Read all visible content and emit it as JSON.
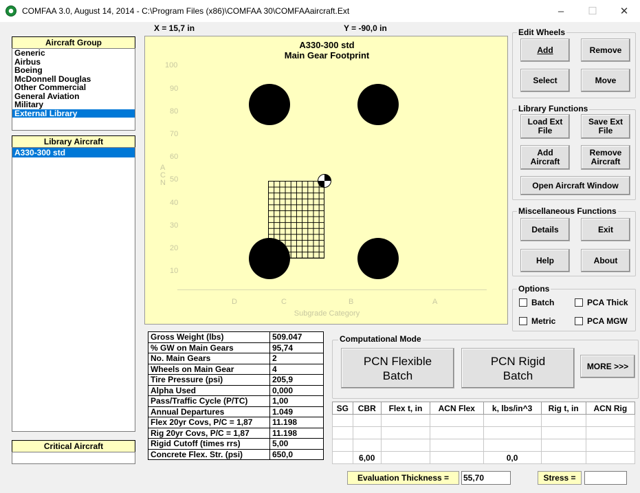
{
  "window": {
    "title": "COMFAA 3.0, August 14, 2014 - C:\\Program Files (x86)\\COMFAA 30\\COMFAAaircraft.Ext",
    "min_glyph": "–",
    "max_glyph": "☐",
    "close_glyph": "✕"
  },
  "coords": {
    "x": "X = 15,7 in",
    "y": "Y = -90,0 in"
  },
  "aircraft_group": {
    "header": "Aircraft Group",
    "items": [
      "Generic",
      "Airbus",
      "Boeing",
      "McDonnell Douglas",
      "Other Commercial",
      "General Aviation",
      "Military",
      "External Library"
    ],
    "selected_index": 7
  },
  "library_aircraft": {
    "header": "Library Aircraft",
    "items": [
      "A330-300 std"
    ],
    "selected_index": 0
  },
  "critical_aircraft": {
    "header": "Critical Aircraft",
    "value": ""
  },
  "plot": {
    "title1": "A330-300 std",
    "title2": "Main Gear Footprint",
    "y_ticks": [
      "100",
      "90",
      "80",
      "70",
      "60",
      "50",
      "40",
      "30",
      "20",
      "10"
    ],
    "y_axis_letters": [
      "A",
      "C",
      "N"
    ],
    "x_ticks": [
      "D",
      "C",
      "B",
      "A"
    ],
    "x_label": "Subgrade Category"
  },
  "edit_wheels": {
    "label": "Edit Wheels",
    "add": "Add",
    "remove": "Remove",
    "select": "Select",
    "move": "Move"
  },
  "library_functions": {
    "label": "Library Functions",
    "load": "Load Ext\nFile",
    "save": "Save Ext\nFile",
    "add_aircraft": "Add\nAircraft",
    "remove_aircraft": "Remove\nAircraft",
    "open_window": "Open Aircraft Window"
  },
  "misc": {
    "label": "Miscellaneous Functions",
    "details": "Details",
    "exit": "Exit",
    "help": "Help",
    "about": "About"
  },
  "options": {
    "label": "Options",
    "batch": "Batch",
    "pca_thick": "PCA Thick",
    "metric": "Metric",
    "pca_mgw": "PCA MGW"
  },
  "params": [
    {
      "label": "Gross Weight (lbs)",
      "value": "509.047"
    },
    {
      "label": "% GW on Main Gears",
      "value": "95,74"
    },
    {
      "label": "No. Main Gears",
      "value": "2"
    },
    {
      "label": "Wheels on Main Gear",
      "value": "4"
    },
    {
      "label": "Tire Pressure (psi)",
      "value": "205,9"
    },
    {
      "label": "Alpha Used",
      "value": "0,000"
    },
    {
      "label": "Pass/Traffic Cycle (P/TC)",
      "value": "1,00"
    },
    {
      "label": "Annual Departures",
      "value": "1.049"
    },
    {
      "label": "Flex 20yr Covs, P/C = 1,87",
      "value": "11.198"
    },
    {
      "label": "Rig 20yr Covs,  P/C = 1,87",
      "value": "11.198"
    },
    {
      "label": "Rigid Cutoff (times rrs)",
      "value": "5,00"
    },
    {
      "label": "Concrete Flex. Str. (psi)",
      "value": "650,0"
    }
  ],
  "computational": {
    "label": "Computational Mode",
    "pcn_flex": "PCN Flexible\nBatch",
    "pcn_rigid": "PCN Rigid\nBatch",
    "more": "MORE >>>"
  },
  "results": {
    "headers": [
      "SG",
      "CBR",
      "Flex t, in",
      "ACN Flex",
      "k, lbs/in^3",
      "Rig t, in",
      "ACN Rig"
    ],
    "rows": [
      [
        "",
        "",
        "",
        "",
        "",
        "",
        ""
      ],
      [
        "",
        "",
        "",
        "",
        "",
        "",
        ""
      ],
      [
        "",
        "",
        "",
        "",
        "",
        "",
        ""
      ],
      [
        "",
        "6,00",
        "",
        "",
        "0,0",
        "",
        ""
      ]
    ]
  },
  "evaluation": {
    "label": "Evaluation Thickness =",
    "value": "55,70"
  },
  "stress": {
    "label": "Stress =",
    "value": ""
  }
}
